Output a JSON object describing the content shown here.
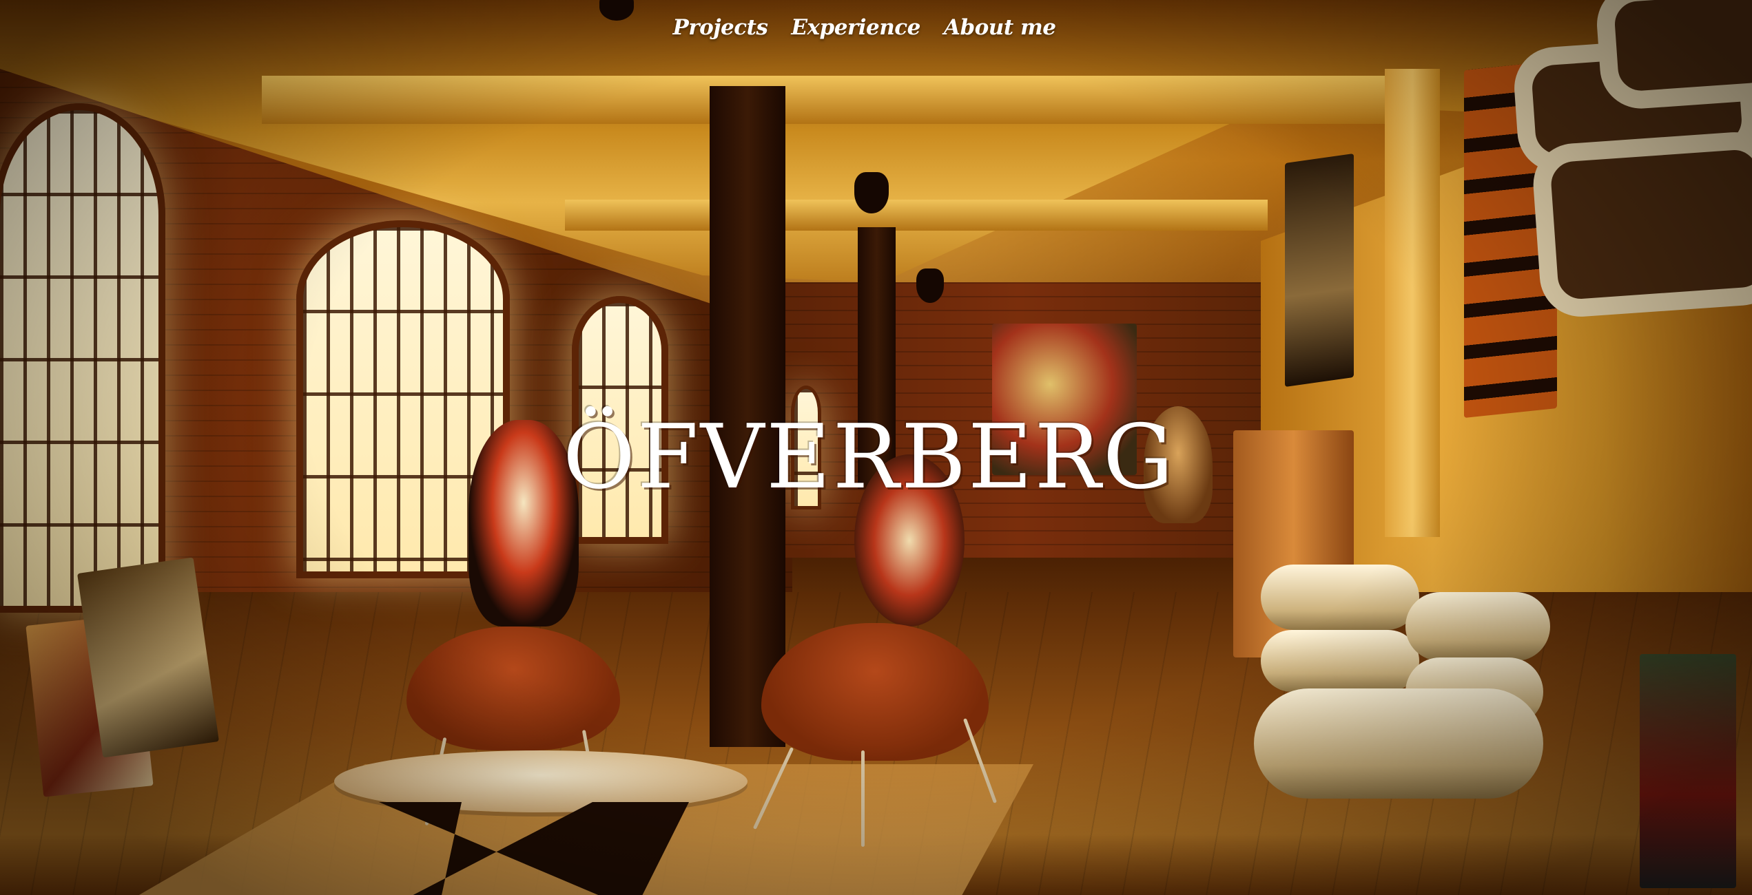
{
  "nav": {
    "items": [
      {
        "label": "Projects"
      },
      {
        "label": "Experience"
      },
      {
        "label": "About me"
      }
    ]
  },
  "hero": {
    "title": "ÖFVERBERG",
    "background": "warm-lit-loft-interior-photo"
  },
  "colors": {
    "text": "#ffffff",
    "tint": "#c98a1e"
  }
}
